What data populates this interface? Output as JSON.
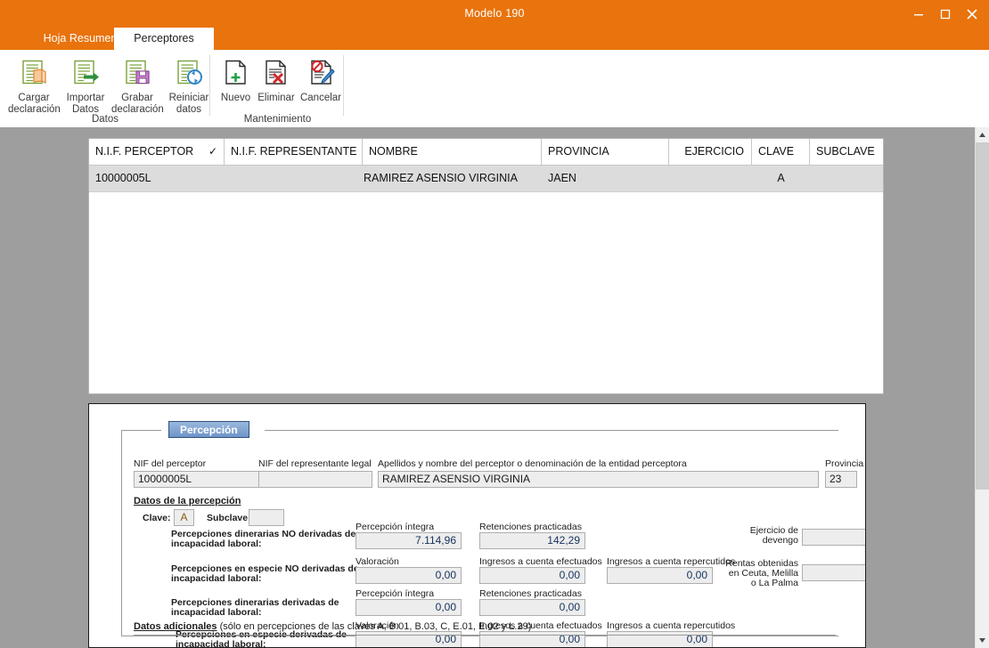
{
  "window": {
    "title": "Modelo 190",
    "controls": [
      {
        "name": "minimize",
        "glyph": "minimize-icon"
      },
      {
        "name": "maximize",
        "glyph": "maximize-icon"
      },
      {
        "name": "close",
        "glyph": "close-icon"
      }
    ]
  },
  "tabs": [
    {
      "id": "hoja-resumen",
      "label": "Hoja Resumen",
      "active": false
    },
    {
      "id": "perceptores",
      "label": "Perceptores",
      "active": true
    }
  ],
  "ribbon": {
    "groups": [
      {
        "id": "datos",
        "label": "Datos",
        "buttons": [
          {
            "id": "cargar-declaracion",
            "label": "Cargar\ndeclaración",
            "icon": "document-load-icon"
          },
          {
            "id": "importar-datos",
            "label": "Importar\nDatos",
            "icon": "document-import-arrow-icon"
          },
          {
            "id": "grabar-declaracion",
            "label": "Grabar\ndeclaración",
            "icon": "document-save-floppy-icon"
          },
          {
            "id": "reiniciar-datos",
            "label": "Reiniciar\ndatos",
            "icon": "document-refresh-icon"
          }
        ]
      },
      {
        "id": "mantenimiento",
        "label": "Mantenimiento",
        "buttons": [
          {
            "id": "nuevo",
            "label": "Nuevo",
            "icon": "document-plus-icon"
          },
          {
            "id": "eliminar",
            "label": "Eliminar",
            "icon": "document-delete-x-icon"
          },
          {
            "id": "cancelar",
            "label": "Cancelar",
            "icon": "document-cancel-pencil-icon"
          }
        ]
      }
    ]
  },
  "grid": {
    "columns": [
      {
        "id": "nif-perceptor",
        "label": "N.I.F. PERCEPTOR",
        "check": "✓"
      },
      {
        "id": "nif-representante",
        "label": "N.I.F. REPRESENTANTE"
      },
      {
        "id": "nombre",
        "label": "NOMBRE"
      },
      {
        "id": "provincia",
        "label": "PROVINCIA"
      },
      {
        "id": "ejercicio",
        "label": "EJERCICIO"
      },
      {
        "id": "clave",
        "label": "CLAVE"
      },
      {
        "id": "subclave",
        "label": "SUBCLAVE"
      }
    ],
    "rows": [
      {
        "nif_perceptor": "10000005L",
        "nif_representante": "",
        "nombre": "RAMIREZ ASENSIO VIRGINIA",
        "provincia": "JAEN",
        "ejercicio": "",
        "clave": "A",
        "subclave": ""
      }
    ]
  },
  "form": {
    "legend": "Percepción",
    "nif_perceptor_label": "NIF del perceptor",
    "nif_perceptor_value": "10000005L",
    "nif_representante_label": "NIF del representante legal",
    "nif_representante_value": "",
    "nombre_label": "Apellidos y nombre del perceptor o denominación de la entidad perceptora",
    "nombre_value": "RAMIREZ ASENSIO VIRGINIA",
    "provincia_label": "Provincia",
    "provincia_value": "23",
    "datos_percepcion_label": "Datos de la percepción",
    "clave_label": "Clave:",
    "clave_value": "A",
    "subclave_label": "Subclave:",
    "subclave_value": "",
    "rows": [
      {
        "id": "dinerarias-no-derivadas",
        "title": "Percepciones dinerarias NO derivadas de\nincapacidad laboral:",
        "c1_label": "Percepción íntegra",
        "c1_value": "7.114,96",
        "c2_label": "Retenciones practicadas",
        "c2_value": "142,29",
        "c3_label": "",
        "c3_value": ""
      },
      {
        "id": "especie-no-derivadas",
        "title": "Percepciones en especie NO derivadas de\nincapacidad laboral:",
        "c1_label": "Valoración",
        "c1_value": "0,00",
        "c2_label": "Ingresos a cuenta efectuados",
        "c2_value": "0,00",
        "c3_label": "Ingresos a cuenta repercutidos",
        "c3_value": "0,00"
      },
      {
        "id": "dinerarias-derivadas",
        "title": "Percepciones dinerarias derivadas de\nincapacidad laboral:",
        "c1_label": "Percepción íntegra",
        "c1_value": "0,00",
        "c2_label": "Retenciones practicadas",
        "c2_value": "0,00",
        "c3_label": "",
        "c3_value": ""
      },
      {
        "id": "especie-derivadas",
        "title": "Percepciones en especie derivadas de\nincapacidad laboral:",
        "c1_label": "Valoración",
        "c1_value": "0,00",
        "c2_label": "Ingresos a cuenta efectuados",
        "c2_value": "0,00",
        "c3_label": "Ingresos a cuenta repercutidos",
        "c3_value": "0,00"
      }
    ],
    "ejercicio_devengo_label": "Ejercicio de\ndevengo",
    "ejercicio_devengo_value": "",
    "rentas_label": "Rentas obtenidas\nen Ceuta, Melilla\no La Palma",
    "rentas_value": "",
    "datos_adicionales_bold": "Datos adicionales",
    "datos_adicionales_rest": " (sólo en percepciones de las claves A, B.01, B.03, C, E.01, E.02 y L.29)"
  },
  "colors": {
    "accent": "#E9730C",
    "desktop": "#9e9e9e",
    "row_selected": "#dcdcdc",
    "field_bg": "#ededed",
    "field_text": "#14325c",
    "legend_blue": "#6e94c8"
  }
}
